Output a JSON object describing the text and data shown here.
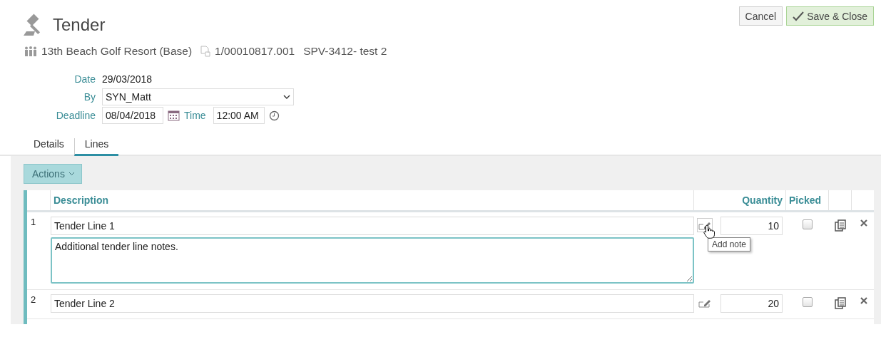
{
  "title": "Tender",
  "buttons": [
    {
      "label": "Cancel",
      "kind": "cancel"
    },
    {
      "label": "Save & Close",
      "kind": "save"
    }
  ],
  "info": {
    "location": "13th Beach Golf Resort (Base)",
    "reference": "1/00010817.001",
    "project": "SPV-3412- test 2"
  },
  "form": {
    "date_label": "Date",
    "date": "29/03/2018",
    "by_label": "By",
    "by": "SYN_Matt",
    "deadline_label": "Deadline",
    "deadline": "08/04/2018",
    "time_label": "Time",
    "time": "12:00 AM"
  },
  "tabs": [
    {
      "label": "Details",
      "selected": false
    },
    {
      "label": "Lines",
      "selected": true
    }
  ],
  "actions_button": "Actions",
  "table": {
    "columns": [
      "Description",
      "Quantity",
      "Picked"
    ],
    "rows": [
      {
        "number": "1",
        "description": "Tender Line 1",
        "notes": "Additional tender line notes.",
        "quantity": "10",
        "picked": false,
        "tooltip": "Add note"
      },
      {
        "number": "2",
        "description": "Tender Line 2",
        "quantity": "20",
        "picked": false
      }
    ]
  }
}
